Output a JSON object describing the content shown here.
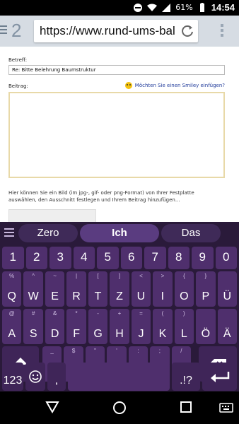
{
  "status_bar": {
    "battery_percent": "61%",
    "time": "14:54",
    "icons": [
      "do-not-disturb-icon",
      "wifi-icon",
      "signal-icon",
      "battery-icon"
    ]
  },
  "browser": {
    "tab_count": "2",
    "url": "https://www.rund-ums-bal"
  },
  "page": {
    "betreff_label": "Betreff:",
    "betreff_value": "Re: Bitte Belehrung Baumstruktur",
    "beitrag_label": "Beitrag:",
    "smiley_link": "Möchten Sie einen Smiley einfügen?",
    "info_line1": "Hier können Sie ein Bild (im jpg-, gif- oder png-Format) von Ihrer Festplatte",
    "info_line2": "auswählen, den Ausschnitt festlegen und Ihrem Beitrag hinzufügen..."
  },
  "keyboard": {
    "suggestions": [
      "Zero",
      "Ich",
      "Das"
    ],
    "number_row": [
      "1",
      "2",
      "3",
      "4",
      "5",
      "6",
      "7",
      "8",
      "9",
      "0"
    ],
    "row1": [
      {
        "main": "Q",
        "alt": "%"
      },
      {
        "main": "W",
        "alt": "^"
      },
      {
        "main": "E",
        "alt": "~"
      },
      {
        "main": "R",
        "alt": "|"
      },
      {
        "main": "T",
        "alt": "["
      },
      {
        "main": "Z",
        "alt": "]"
      },
      {
        "main": "U",
        "alt": "<"
      },
      {
        "main": "I",
        "alt": ">"
      },
      {
        "main": "O",
        "alt": "{"
      },
      {
        "main": "P",
        "alt": "}"
      },
      {
        "main": "Ü",
        "alt": ""
      }
    ],
    "row2": [
      {
        "main": "A",
        "alt": "@"
      },
      {
        "main": "S",
        "alt": "#"
      },
      {
        "main": "D",
        "alt": "&"
      },
      {
        "main": "F",
        "alt": "*"
      },
      {
        "main": "G",
        "alt": "-"
      },
      {
        "main": "H",
        "alt": "+"
      },
      {
        "main": "J",
        "alt": "="
      },
      {
        "main": "K",
        "alt": "("
      },
      {
        "main": "L",
        "alt": ")"
      },
      {
        "main": "Ö",
        "alt": ""
      },
      {
        "main": "Ä",
        "alt": ""
      }
    ],
    "row3": [
      {
        "main": "Y",
        "alt": "_"
      },
      {
        "main": "X",
        "alt": "$"
      },
      {
        "main": "C",
        "alt": "\""
      },
      {
        "main": "V",
        "alt": "'"
      },
      {
        "main": "B",
        "alt": ":"
      },
      {
        "main": "N",
        "alt": ";"
      },
      {
        "main": "M",
        "alt": "/"
      }
    ],
    "bottom": {
      "numbers_label": "123",
      "comma": ",",
      "punct": ".!?"
    }
  },
  "nav": [
    "back-icon",
    "home-icon",
    "recents-icon",
    "keyboard-switch-icon"
  ]
}
